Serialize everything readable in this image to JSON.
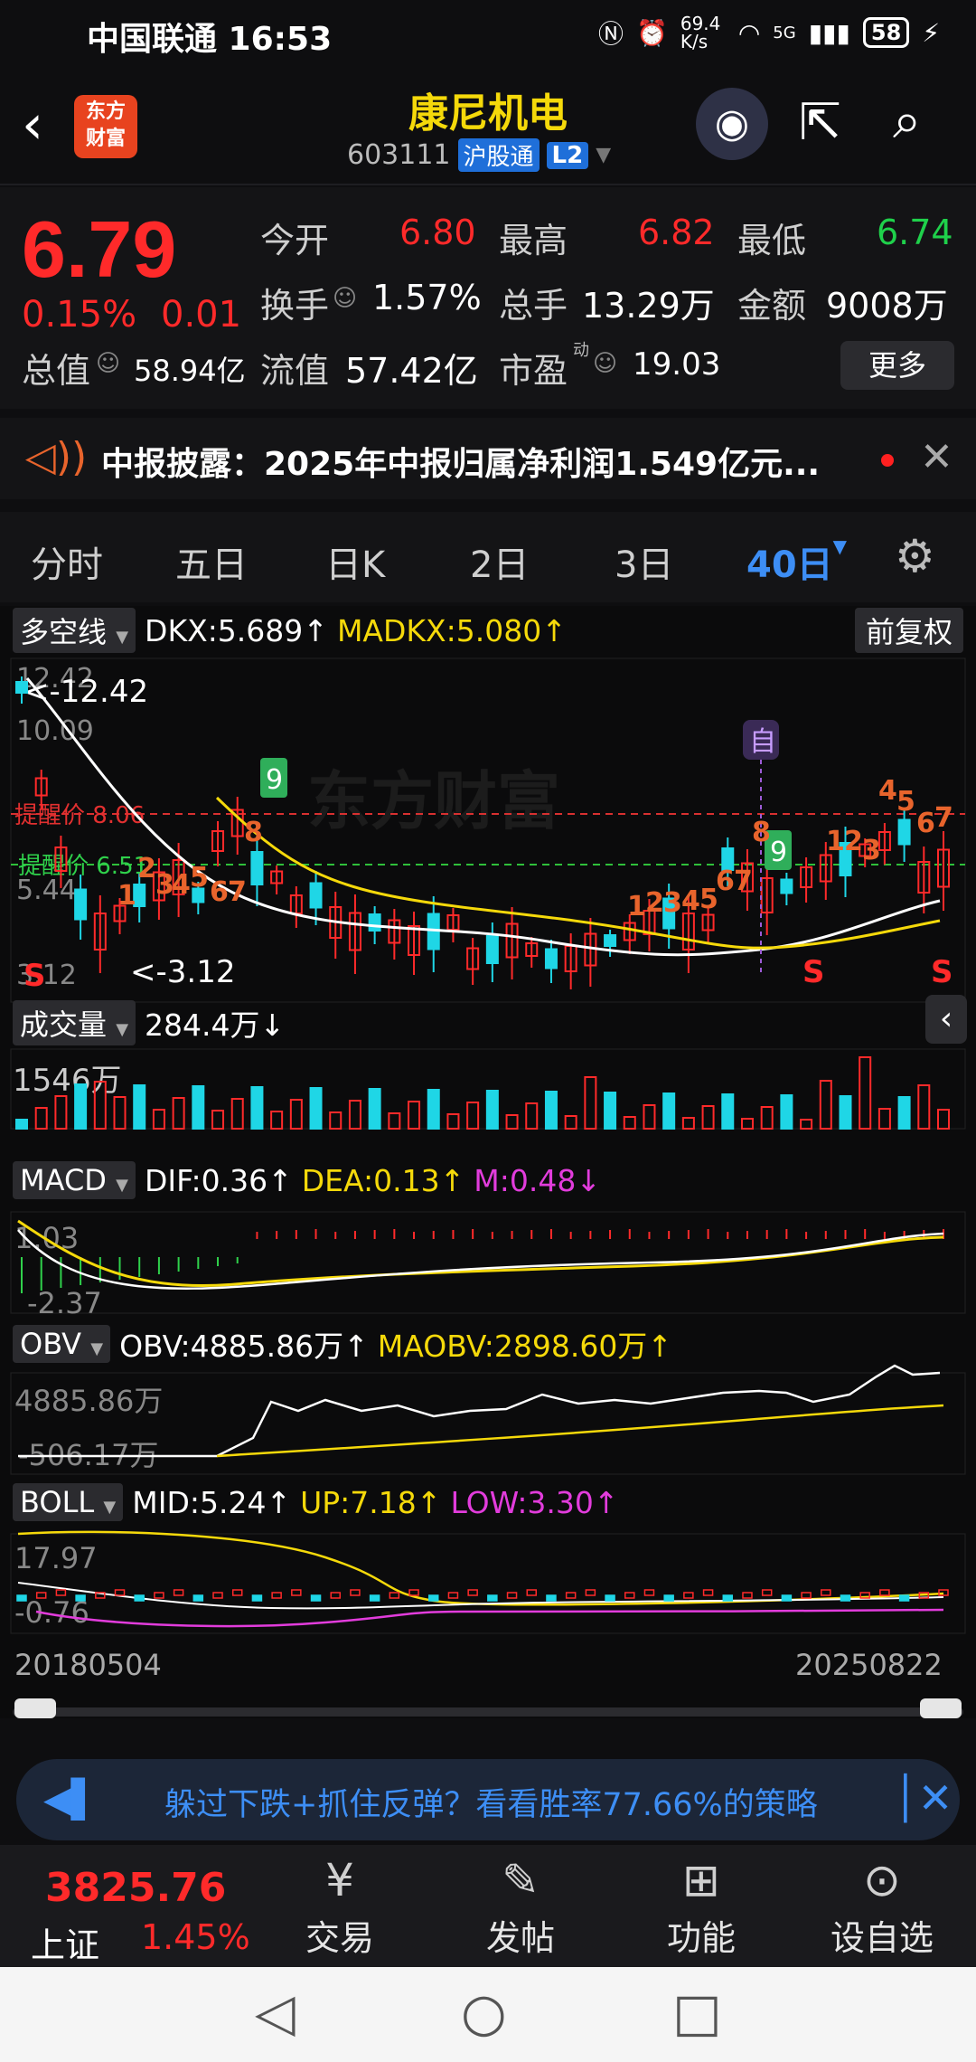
{
  "status": {
    "carrier_time": "中国联通 16:53",
    "speed": "69.4 K/s",
    "network": "5G",
    "battery": "58"
  },
  "header": {
    "logo": "东方财富",
    "name": "康尼机电",
    "code": "603111",
    "tag_hgt": "沪股通",
    "tag_l2": "L2"
  },
  "quote": {
    "price": "6.79",
    "change_pct": "0.15%",
    "change_abs": "0.01",
    "open_label": "今开",
    "open": "6.80",
    "high_label": "最高",
    "high": "6.82",
    "low_label": "最低",
    "low": "6.74",
    "turnover_label": "换手",
    "turnover": "1.57%",
    "volume_label": "总手",
    "volume": "13.29万",
    "amount_label": "金额",
    "amount": "9008万",
    "mktcap_label": "总值",
    "mktcap": "58.94亿",
    "float_label": "流值",
    "float": "57.42亿",
    "pe_label": "市盈",
    "pe_sup": "动",
    "pe": "19.03",
    "more": "更多"
  },
  "notice": {
    "text": "中报披露：2025年中报归属净利润1.549亿元..."
  },
  "tabs": [
    "分时",
    "五日",
    "日K",
    "2日",
    "3日",
    "40日"
  ],
  "active_tab": "40日",
  "kline": {
    "indicator": "多空线",
    "dkx": "DKX:5.689↑",
    "madkx": "MADKX:5.080↑",
    "fuquan": "前复权",
    "y_max": "12.42",
    "y_2": "10.09",
    "y_3": "5.44",
    "y_min": "3.12",
    "max_mark": "<-12.42",
    "min_mark": "<-3.12",
    "alert_high": "提醒价 8.06",
    "alert_low": "提醒价 6.51",
    "self_tag": "自",
    "s_marks": [
      "S",
      "S",
      "S"
    ],
    "nine_tags": [
      "9",
      "9"
    ],
    "seq_left": [
      "1",
      "2",
      "3",
      "4",
      "5",
      "6",
      "7",
      "8"
    ],
    "seq_mid": [
      "1",
      "2",
      "3",
      "4",
      "5",
      "6",
      "7",
      "8"
    ],
    "seq_right1": [
      "1",
      "2",
      "3"
    ],
    "seq_right2": [
      "4",
      "5",
      "6",
      "7"
    ]
  },
  "volume": {
    "indicator": "成交量",
    "value": "284.4万↓",
    "y_max": "1546万"
  },
  "macd": {
    "indicator": "MACD",
    "dif": "DIF:0.36↑",
    "dea": "DEA:0.13↑",
    "m": "M:0.48↓",
    "y_max": "1.03",
    "y_min": "-2.37"
  },
  "obv": {
    "indicator": "OBV",
    "obv": "OBV:4885.86万↑",
    "maobv": "MAOBV:2898.60万↑",
    "y_max": "4885.86万",
    "y_min": "-506.17万"
  },
  "boll": {
    "indicator": "BOLL",
    "mid": "MID:5.24↑",
    "up": "UP:7.18↑",
    "low": "LOW:3.30↑",
    "y_max": "17.97",
    "y_min": "-0.76"
  },
  "date_range": {
    "start": "20180504",
    "end": "20250822"
  },
  "banner": {
    "text": "躲过下跌+抓住反弹？看看胜率77.66%的策略"
  },
  "bottom": {
    "index_value": "3825.76",
    "index_name": "上证",
    "index_pct": "1.45%",
    "items": [
      "交易",
      "发帖",
      "功能",
      "设自选"
    ]
  },
  "colors": {
    "up": "#ff2a2a",
    "down": "#1fd14b",
    "accent": "#3d8ef5",
    "dkx_line": "#ffffff",
    "madkx_line": "#f5d90a",
    "seq_tag": "#e8642c"
  }
}
